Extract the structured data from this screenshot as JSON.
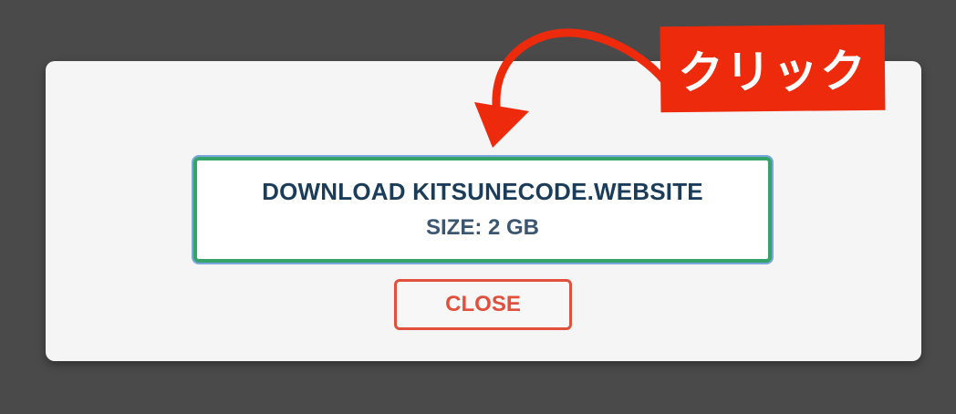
{
  "dialog": {
    "download_title": "DOWNLOAD KITSUNECODE.WEBSITE",
    "download_size": "SIZE: 2 GB",
    "close_label": "CLOSE"
  },
  "annotation": {
    "label": "クリック",
    "icon": "curved-arrow-icon"
  },
  "colors": {
    "backdrop": "#4a4a4a",
    "modal_background": "#f5f5f5",
    "download_border": "#35a36a",
    "download_text": "#1c3d5a",
    "close_accent": "#e0503c",
    "annotation_red": "#ee2a0c"
  }
}
